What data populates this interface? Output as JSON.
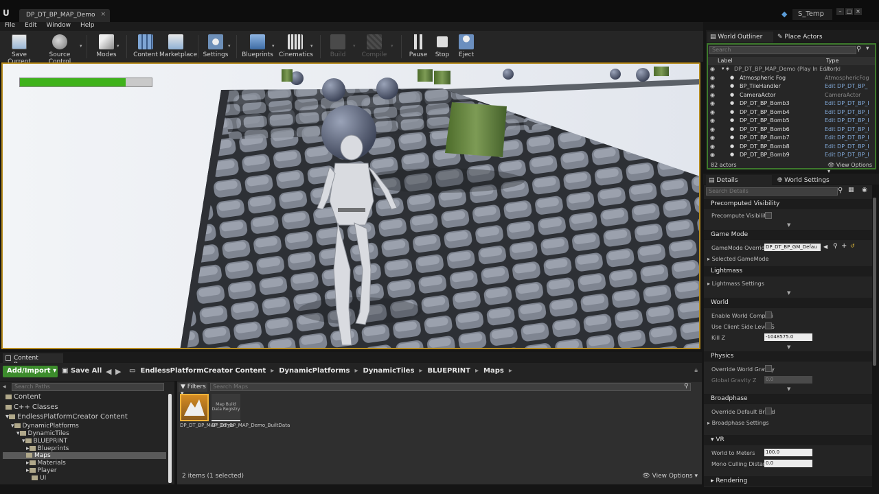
{
  "titlebar": {
    "doc_tab": "DP_DT_BP_MAP_Demo",
    "project": "S_Temp"
  },
  "menu": [
    "File",
    "Edit",
    "Window",
    "Help"
  ],
  "toolbar": {
    "save_current": "Save Current",
    "source_control": "Source Control",
    "modes": "Modes",
    "content": "Content",
    "marketplace": "Marketplace",
    "settings": "Settings",
    "blueprints": "Blueprints",
    "cinematics": "Cinematics",
    "build": "Build",
    "compile": "Compile",
    "pause": "Pause",
    "stop": "Stop",
    "eject": "Eject"
  },
  "viewport": {
    "health_fraction": 0.8
  },
  "content_browser": {
    "tab": "Content Browser",
    "add_import": "Add/Import",
    "save_all": "Save All",
    "breadcrumbs": [
      "EndlessPlatformCreator Content",
      "DynamicPlatforms",
      "DynamicTiles",
      "BLUEPRINT",
      "Maps"
    ],
    "search_paths_placeholder": "Search Paths",
    "search_maps_placeholder": "Search Maps",
    "filters": "Filters",
    "tree": {
      "content": "Content",
      "cpp_classes": "C++ Classes",
      "epc_content": "EndlessPlatformCreator Content",
      "dynamic_platforms": "DynamicPlatforms",
      "dynamic_tiles": "DynamicTiles",
      "blueprint": "BLUEPRINT",
      "blueprints": "Blueprints",
      "maps": "Maps",
      "materials": "Materials",
      "player": "Player",
      "ui": "UI"
    },
    "assets": {
      "map_name": "DP_DT_BP_MAP_Demo",
      "builtdata_thumb": "Map Build Data Registry",
      "builtdata_name": "DP_DT_BP_MAP_Demo_BuiltData"
    },
    "status": "2 items (1 selected)",
    "view_options": "View Options"
  },
  "outliner": {
    "tab_outliner": "World Outliner",
    "tab_place": "Place Actors",
    "search_placeholder": "Search",
    "col_label": "Label",
    "col_type": "Type",
    "rows": [
      {
        "label": "DP_DT_BP_MAP_Demo (Play In Editor)",
        "type": "World"
      },
      {
        "label": "Atmospheric Fog",
        "type": "AtmosphericFog"
      },
      {
        "label": "BP_TileHandler",
        "type": "Edit DP_DT_BP_"
      },
      {
        "label": "CameraActor",
        "type": "CameraActor"
      },
      {
        "label": "DP_DT_BP_Bomb3",
        "type": "Edit DP_DT_BP_I"
      },
      {
        "label": "DP_DT_BP_Bomb4",
        "type": "Edit DP_DT_BP_I"
      },
      {
        "label": "DP_DT_BP_Bomb5",
        "type": "Edit DP_DT_BP_I"
      },
      {
        "label": "DP_DT_BP_Bomb6",
        "type": "Edit DP_DT_BP_I"
      },
      {
        "label": "DP_DT_BP_Bomb7",
        "type": "Edit DP_DT_BP_I"
      },
      {
        "label": "DP_DT_BP_Bomb8",
        "type": "Edit DP_DT_BP_I"
      },
      {
        "label": "DP_DT_BP_Bomb9",
        "type": "Edit DP_DT_BP_I"
      }
    ],
    "actors": "82 actors",
    "view_options": "View Options"
  },
  "details": {
    "tab_details": "Details",
    "tab_world": "World Settings",
    "search_placeholder": "Search Details",
    "precomputed_visibility": "Precomputed Visibility",
    "precompute_visibility": "Precompute Visibility",
    "game_mode": "Game Mode",
    "gamemode_override": "GameMode Override",
    "gamemode_value": "DP_DT_BP_GM_Defau",
    "selected_gamemode": "Selected GameMode",
    "lightmass": "Lightmass",
    "lightmass_settings": "Lightmass Settings",
    "world": "World",
    "enable_world_composition": "Enable World Composi",
    "use_client_side_level": "Use Client Side Level S",
    "kill_z": "Kill Z",
    "kill_z_value": "-1048575.0",
    "physics": "Physics",
    "override_world_gravity": "Override World Gravity",
    "global_gravity_z": "Global Gravity Z",
    "global_gravity_value": "0.0",
    "broadphase": "Broadphase",
    "override_default_broadphase": "Override Default Broad",
    "broadphase_settings": "Broadphase Settings",
    "vr": "VR",
    "world_to_meters": "World to Meters",
    "world_to_meters_value": "100.0",
    "mono_culling_distance": "Mono Culling Distance",
    "mono_culling_value": "0.0",
    "rendering": "Rendering"
  }
}
